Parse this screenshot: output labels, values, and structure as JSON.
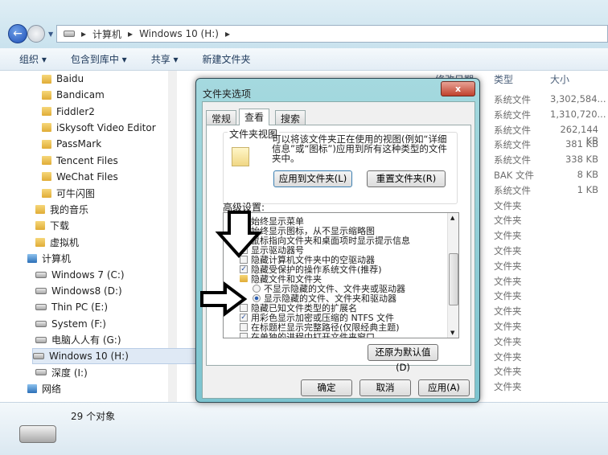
{
  "address": {
    "crumbs": [
      "计算机",
      "Windows 10 (H:)"
    ]
  },
  "toolbar": {
    "organize": "组织 ▾",
    "include": "包含到库中 ▾",
    "share": "共享 ▾",
    "new_folder": "新建文件夹"
  },
  "sidebar": {
    "items": [
      {
        "label": "Baidu",
        "icon": "folder"
      },
      {
        "label": "Bandicam",
        "icon": "folder"
      },
      {
        "label": "Fiddler2",
        "icon": "folder"
      },
      {
        "label": "iSkysoft Video Editor",
        "icon": "folder"
      },
      {
        "label": "PassMark",
        "icon": "folder"
      },
      {
        "label": "Tencent Files",
        "icon": "folder"
      },
      {
        "label": "WeChat Files",
        "icon": "folder"
      },
      {
        "label": "可牛闪图",
        "icon": "folder"
      },
      {
        "label": "我的音乐",
        "icon": "library"
      },
      {
        "label": "下载",
        "icon": "library"
      },
      {
        "label": "虚拟机",
        "icon": "library"
      },
      {
        "label": "计算机",
        "icon": "computer"
      },
      {
        "label": "Windows 7  (C:)",
        "icon": "drive"
      },
      {
        "label": "Windows8 (D:)",
        "icon": "drive"
      },
      {
        "label": "Thin PC (E:)",
        "icon": "drive"
      },
      {
        "label": "System (F:)",
        "icon": "drive"
      },
      {
        "label": "电脑人人有 (G:)",
        "icon": "drive"
      },
      {
        "label": "Windows 10 (H:)",
        "icon": "drive"
      },
      {
        "label": "深度 (I:)",
        "icon": "drive"
      },
      {
        "label": "网络",
        "icon": "network"
      }
    ]
  },
  "list": {
    "headers": {
      "modified": "修改日期",
      "type": "类型",
      "size": "大小"
    },
    "rows": [
      [
        "系统文件",
        "3,302,584..."
      ],
      [
        "系统文件",
        "1,310,720..."
      ],
      [
        "系统文件",
        "262,144 KB"
      ],
      [
        "系统文件",
        "381 KB"
      ],
      [
        "系统文件",
        "338 KB"
      ],
      [
        "BAK 文件",
        "8 KB"
      ],
      [
        "系统文件",
        "1 KB"
      ],
      [
        "文件夹",
        ""
      ],
      [
        "文件夹",
        ""
      ],
      [
        "文件夹",
        ""
      ],
      [
        "文件夹",
        ""
      ],
      [
        "文件夹",
        ""
      ],
      [
        "文件夹",
        ""
      ],
      [
        "文件夹",
        ""
      ],
      [
        "文件夹",
        ""
      ],
      [
        "文件夹",
        ""
      ],
      [
        "文件夹",
        ""
      ],
      [
        "文件夹",
        ""
      ],
      [
        "文件夹",
        ""
      ],
      [
        "文件夹",
        ""
      ]
    ]
  },
  "status": {
    "count": "29 个对象"
  },
  "dialog": {
    "title": "文件夹选项",
    "close": "x",
    "tabs": [
      "常规",
      "查看",
      "搜索"
    ],
    "folder_view": {
      "label": "文件夹视图",
      "desc": "可以将该文件夹正在使用的视图(例如“详细信息”或“图标”)应用到所有这种类型的文件夹中。",
      "apply": "应用到文件夹(L)",
      "reset": "重置文件夹(R)"
    },
    "advanced_label": "高级设置:",
    "options": [
      {
        "text": "始终显示菜单",
        "kind": "check",
        "checked": false,
        "indent": 0
      },
      {
        "text": "始终显示图标，从不显示缩略图",
        "kind": "check",
        "checked": false,
        "indent": 0
      },
      {
        "text": "鼠标指向文件夹和桌面项时显示提示信息",
        "kind": "check",
        "checked": false,
        "indent": 0
      },
      {
        "text": "显示驱动器号",
        "kind": "check",
        "checked": false,
        "indent": 0
      },
      {
        "text": "隐藏计算机文件夹中的空驱动器",
        "kind": "check",
        "checked": false,
        "indent": 0
      },
      {
        "text": "隐藏受保护的操作系统文件(推荐)",
        "kind": "check",
        "checked": true,
        "indent": 0
      },
      {
        "text": "隐藏文件和文件夹",
        "kind": "folder",
        "checked": false,
        "indent": 0
      },
      {
        "text": "不显示隐藏的文件、文件夹或驱动器",
        "kind": "radio",
        "checked": false,
        "indent": 1
      },
      {
        "text": "显示隐藏的文件、文件夹和驱动器",
        "kind": "radio",
        "checked": true,
        "indent": 1
      },
      {
        "text": "隐藏已知文件类型的扩展名",
        "kind": "check",
        "checked": false,
        "indent": 0
      },
      {
        "text": "用彩色显示加密或压缩的 NTFS 文件",
        "kind": "check",
        "checked": true,
        "indent": 0
      },
      {
        "text": "在标题栏显示完整路径(仅限经典主题)",
        "kind": "check",
        "checked": false,
        "indent": 0
      },
      {
        "text": "在单独的进程中打开文件夹窗口",
        "kind": "check",
        "checked": false,
        "indent": 0
      }
    ],
    "restore": "还原为默认值(D)",
    "ok": "确定",
    "cancel": "取消",
    "apply": "应用(A)"
  }
}
